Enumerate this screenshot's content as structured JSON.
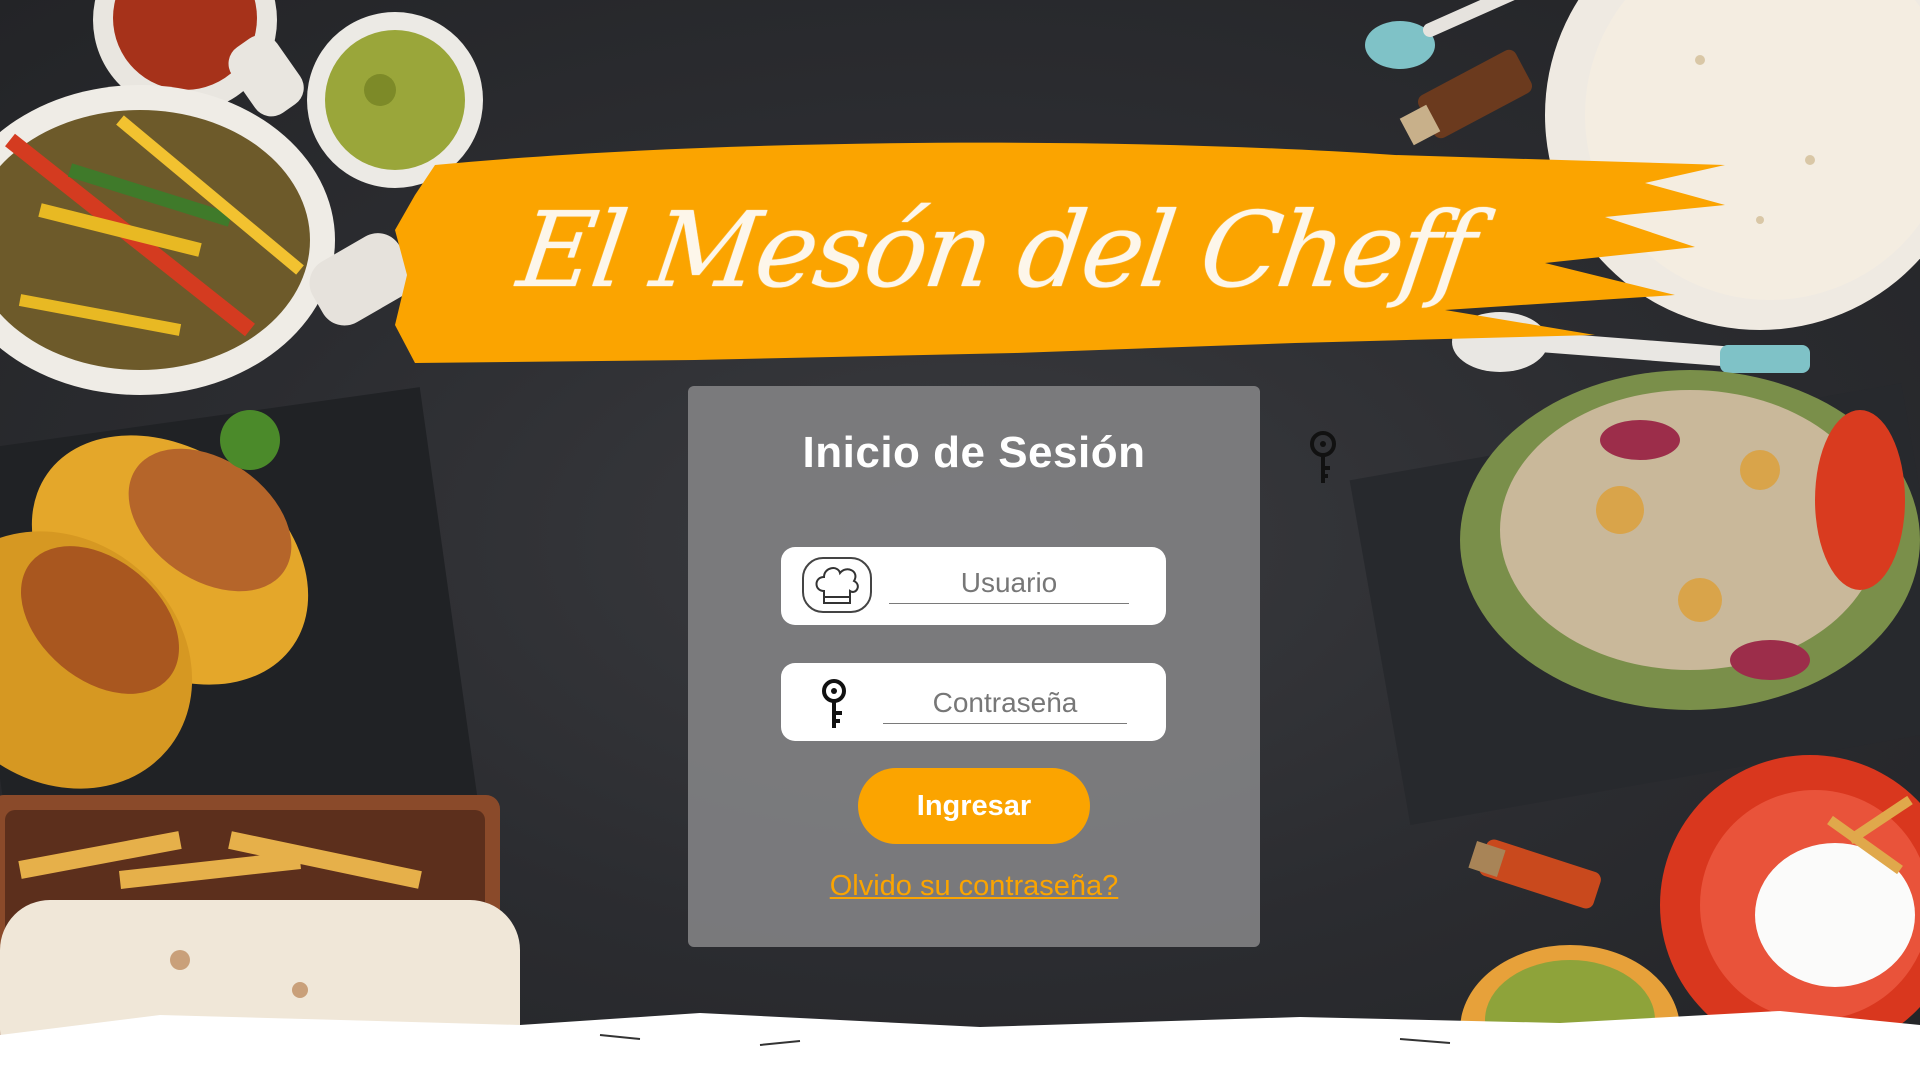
{
  "app": {
    "title": "El Mesón del Cheff"
  },
  "login": {
    "title": "Inicio de Sesión",
    "username_placeholder": "Usuario",
    "password_placeholder": "Contraseña",
    "submit_label": "Ingresar",
    "forgot_label": "Olvido su contraseña?"
  },
  "icons": {
    "user_field_icon": "chef-hat-icon",
    "password_field_icon": "key-icon",
    "floating_icon": "key-icon"
  },
  "colors": {
    "accent": "#fba400",
    "panel": "#808082",
    "background": "#2b2c30",
    "title_text": "#fdf6ea"
  }
}
